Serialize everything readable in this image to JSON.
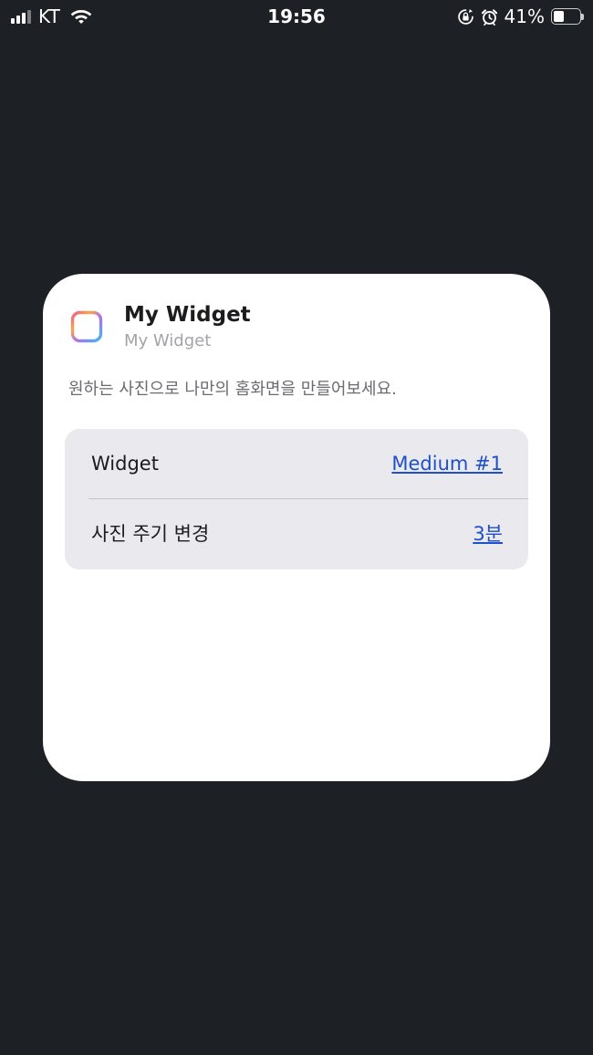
{
  "status_bar": {
    "carrier": "KT",
    "time": "19:56",
    "battery_percent_label": "41%",
    "battery_level": 0.41,
    "icons": [
      "cellular-signal-icon",
      "wifi-icon",
      "rotation-lock-icon",
      "alarm-icon",
      "battery-icon"
    ]
  },
  "widget": {
    "app_icon": "app-icon",
    "title": "My Widget",
    "subtitle": "My Widget",
    "description": "원하는 사진으로 나만의 홈화면을 만들어보세요.",
    "settings": [
      {
        "label": "Widget",
        "value": "Medium #1"
      },
      {
        "label": "사진 주기 변경",
        "value": "3분"
      }
    ]
  },
  "colors": {
    "background": "#1d2024",
    "card": "#ffffff",
    "settings_group": "#e9e9ee",
    "link": "#1f4fc9"
  }
}
